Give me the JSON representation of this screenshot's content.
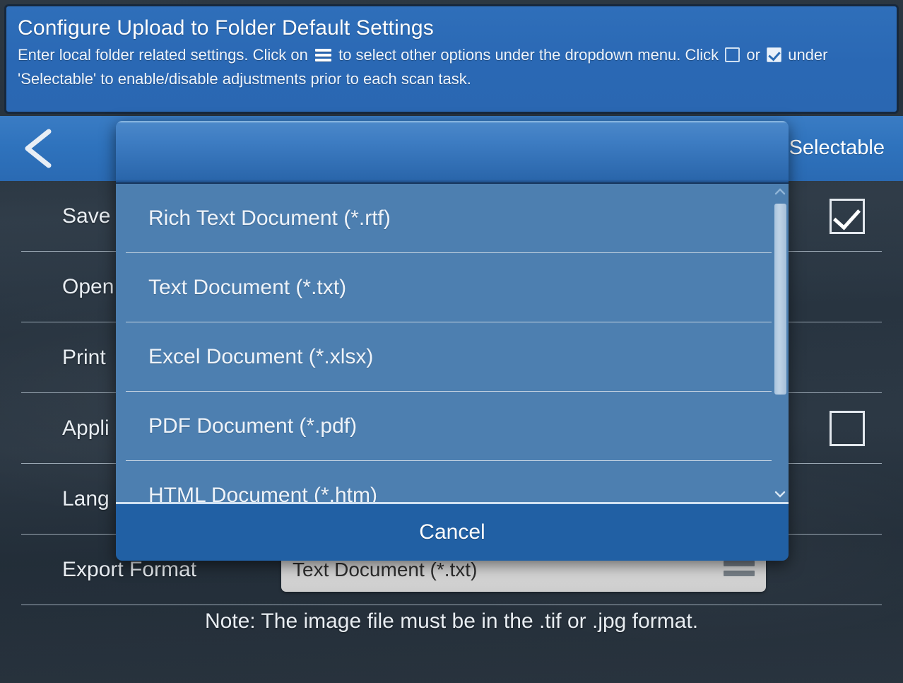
{
  "banner": {
    "title": "Configure Upload to Folder Default Settings",
    "desc_part1": "Enter local folder related settings. Click on ",
    "desc_part2": " to select other options under the dropdown menu. Click ",
    "desc_part3": " or ",
    "desc_part4": " under 'Selectable' to enable/disable adjustments prior to each scan task.",
    "menu_icon": "hamburger-icon",
    "unchecked_icon": "checkbox-unchecked-icon",
    "checked_icon": "checkbox-checked-icon"
  },
  "navbar": {
    "back_icon": "back-chevron-icon",
    "selectable_header": "Selectable"
  },
  "settings": {
    "rows": [
      {
        "label": "Save",
        "selectable": true,
        "checked": true,
        "value": ""
      },
      {
        "label": "Open",
        "selectable": false,
        "checked": false,
        "value": ""
      },
      {
        "label": "Print",
        "selectable": false,
        "checked": false,
        "value": ""
      },
      {
        "label": "Appli",
        "selectable": true,
        "checked": false,
        "value": ""
      },
      {
        "label": "Lang",
        "selectable": false,
        "checked": false,
        "value": ""
      },
      {
        "label": "Export Format",
        "selectable": false,
        "checked": false,
        "value": "Text Document (*.txt)"
      }
    ],
    "note": "Note: The image file must be in the .tif or .jpg format."
  },
  "modal": {
    "title": "",
    "items": [
      {
        "label": "Rich Text Document (*.rtf)"
      },
      {
        "label": "Text Document (*.txt)"
      },
      {
        "label": "Excel Document (*.xlsx)"
      },
      {
        "label": "PDF Document (*.pdf)"
      },
      {
        "label": "HTML Document (*.htm)"
      }
    ],
    "cancel_label": "Cancel",
    "scroll_up_icon": "chevron-up-icon",
    "scroll_down_icon": "chevron-down-icon"
  },
  "colors": {
    "banner_blue": "#2a68b4",
    "navbar_blue": "#2f73bd",
    "modal_list_blue": "#4d7fb0",
    "footer_blue": "#2160a4",
    "background_slate": "#2b3845"
  }
}
